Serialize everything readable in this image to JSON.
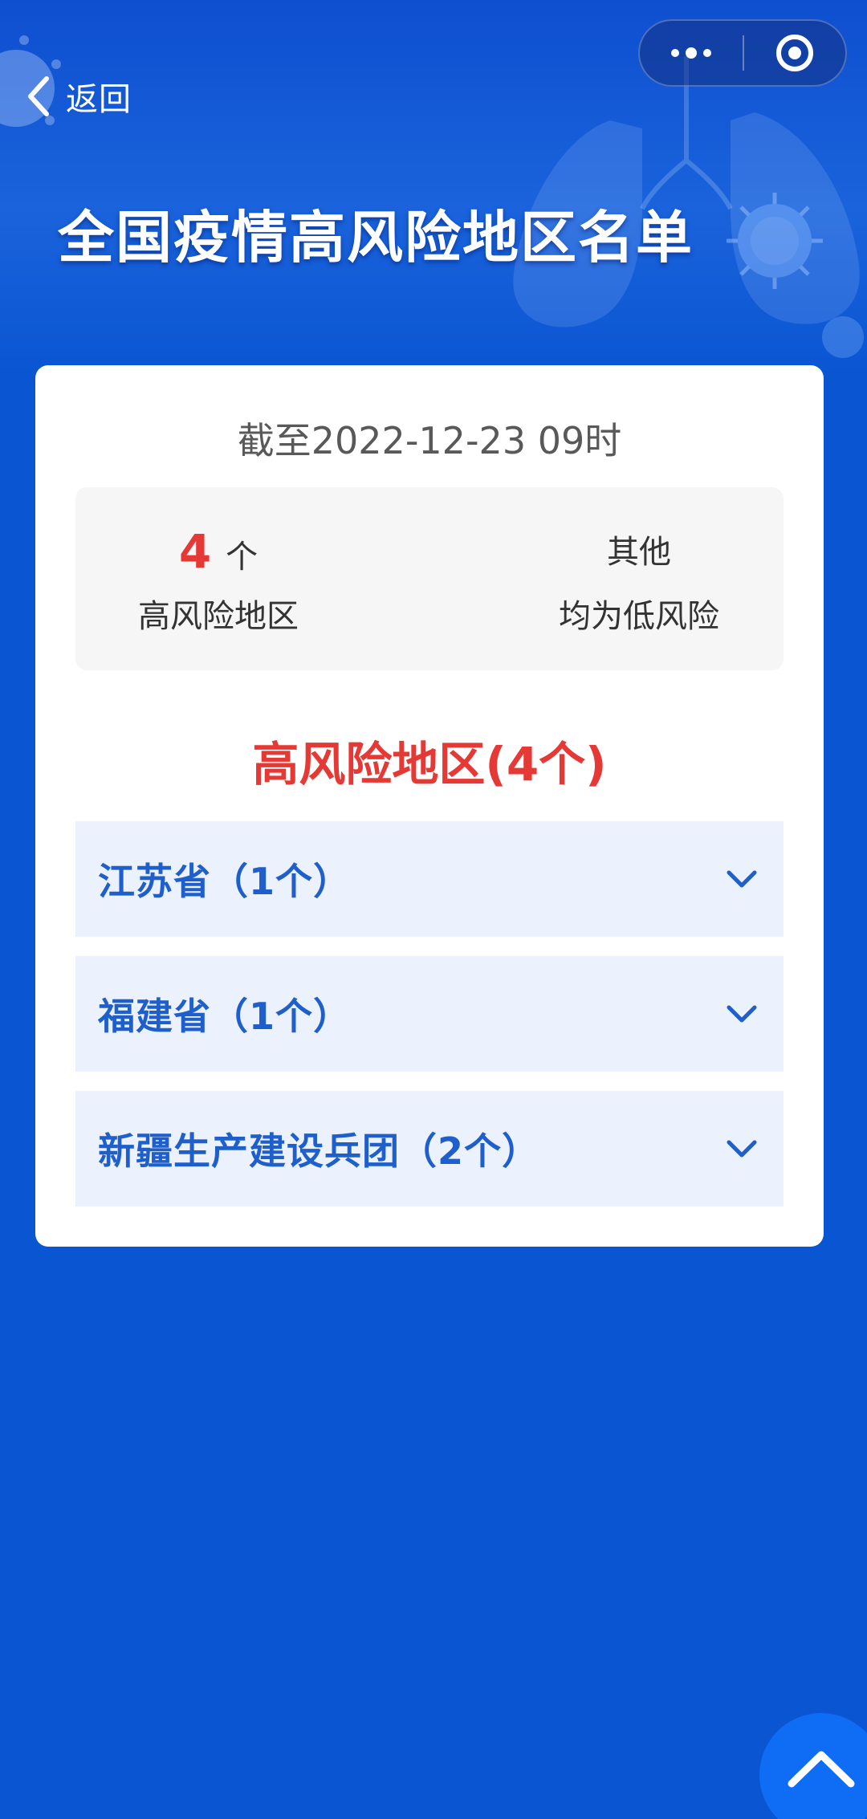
{
  "nav": {
    "back_label": "返回"
  },
  "header": {
    "title": "全国疫情高风险地区名单"
  },
  "summary": {
    "update_time": "截至2022-12-23 09时",
    "high_risk_count": "4",
    "count_unit": "个",
    "high_risk_caption": "高风险地区",
    "other_label": "其他",
    "other_caption": "均为低风险"
  },
  "list": {
    "heading": "高风险地区(4个)",
    "regions": [
      {
        "name": "江苏省（1个）"
      },
      {
        "name": "福建省（1个）"
      },
      {
        "name": "新疆生产建设兵团（2个）"
      }
    ]
  },
  "icons": {
    "back": "chevron-left-icon",
    "more": "more-dots-icon",
    "close": "target-circle-icon",
    "expand": "chevron-down-icon",
    "scroll_top": "chevron-up-icon"
  },
  "colors": {
    "background": "#0a55d2",
    "accent_red": "#e53935",
    "region_text": "#1f5fcb",
    "region_bg": "#ebf2fd",
    "scroll_button": "#0f6cf4"
  }
}
